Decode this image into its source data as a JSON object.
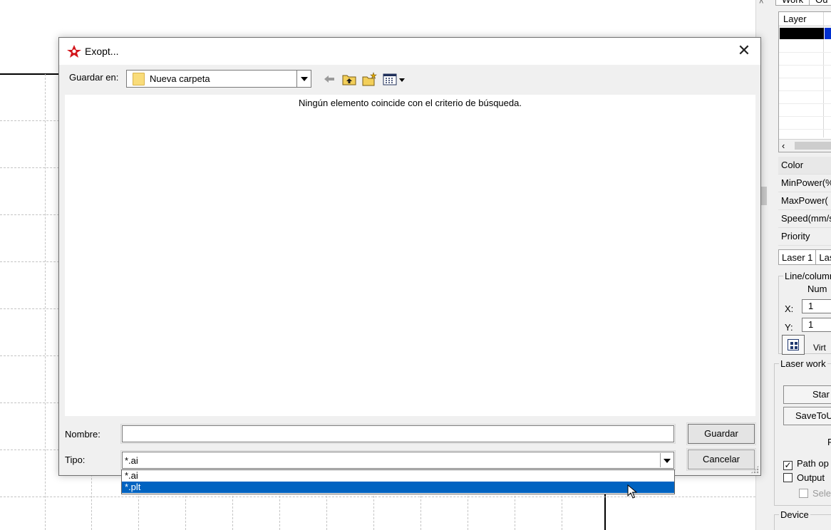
{
  "dialog": {
    "title": "Exopt...",
    "close_icon": "close-icon",
    "save_in_label": "Guardar en:",
    "folder": "Nueva carpeta",
    "empty_message": "Ningún elemento coincide con el criterio de búsqueda.",
    "name_label": "Nombre:",
    "name_value": "",
    "type_label": "Tipo:",
    "type_value": "*.ai",
    "type_options": [
      "*.ai",
      "*.plt"
    ],
    "type_selected_option": "*.plt",
    "save_button": "Guardar",
    "cancel_button": "Cancelar",
    "toolbar_icons": [
      "back-arrow-icon",
      "up-folder-icon",
      "new-folder-icon",
      "view-menu-icon"
    ]
  },
  "right_panel": {
    "top_tabs": [
      "Work",
      "Ou"
    ],
    "layer_header": "Layer",
    "properties": [
      "Color",
      "MinPower(%",
      "MaxPower(",
      "Speed(mm/s",
      "Priority"
    ],
    "laser_tabs": [
      "Laser 1",
      "Las"
    ],
    "line_column_legend": "Line/column",
    "num_label": "Num",
    "x_label": "X:",
    "x_value": "1",
    "y_label": "Y:",
    "y_value": "1",
    "virtual_label": "Virt",
    "laser_work_legend": "Laser work",
    "start_button": "Star",
    "save_to_button": "SaveToU",
    "p_label": "P",
    "path_checkbox": "Path op",
    "output_checkbox": "Output",
    "select_checkbox": "Sele",
    "device_legend": "Device"
  },
  "colors": {
    "accent": "#0063c1",
    "layer_blue": "#0030d0",
    "dialog_bg": "#f0f0f0"
  }
}
